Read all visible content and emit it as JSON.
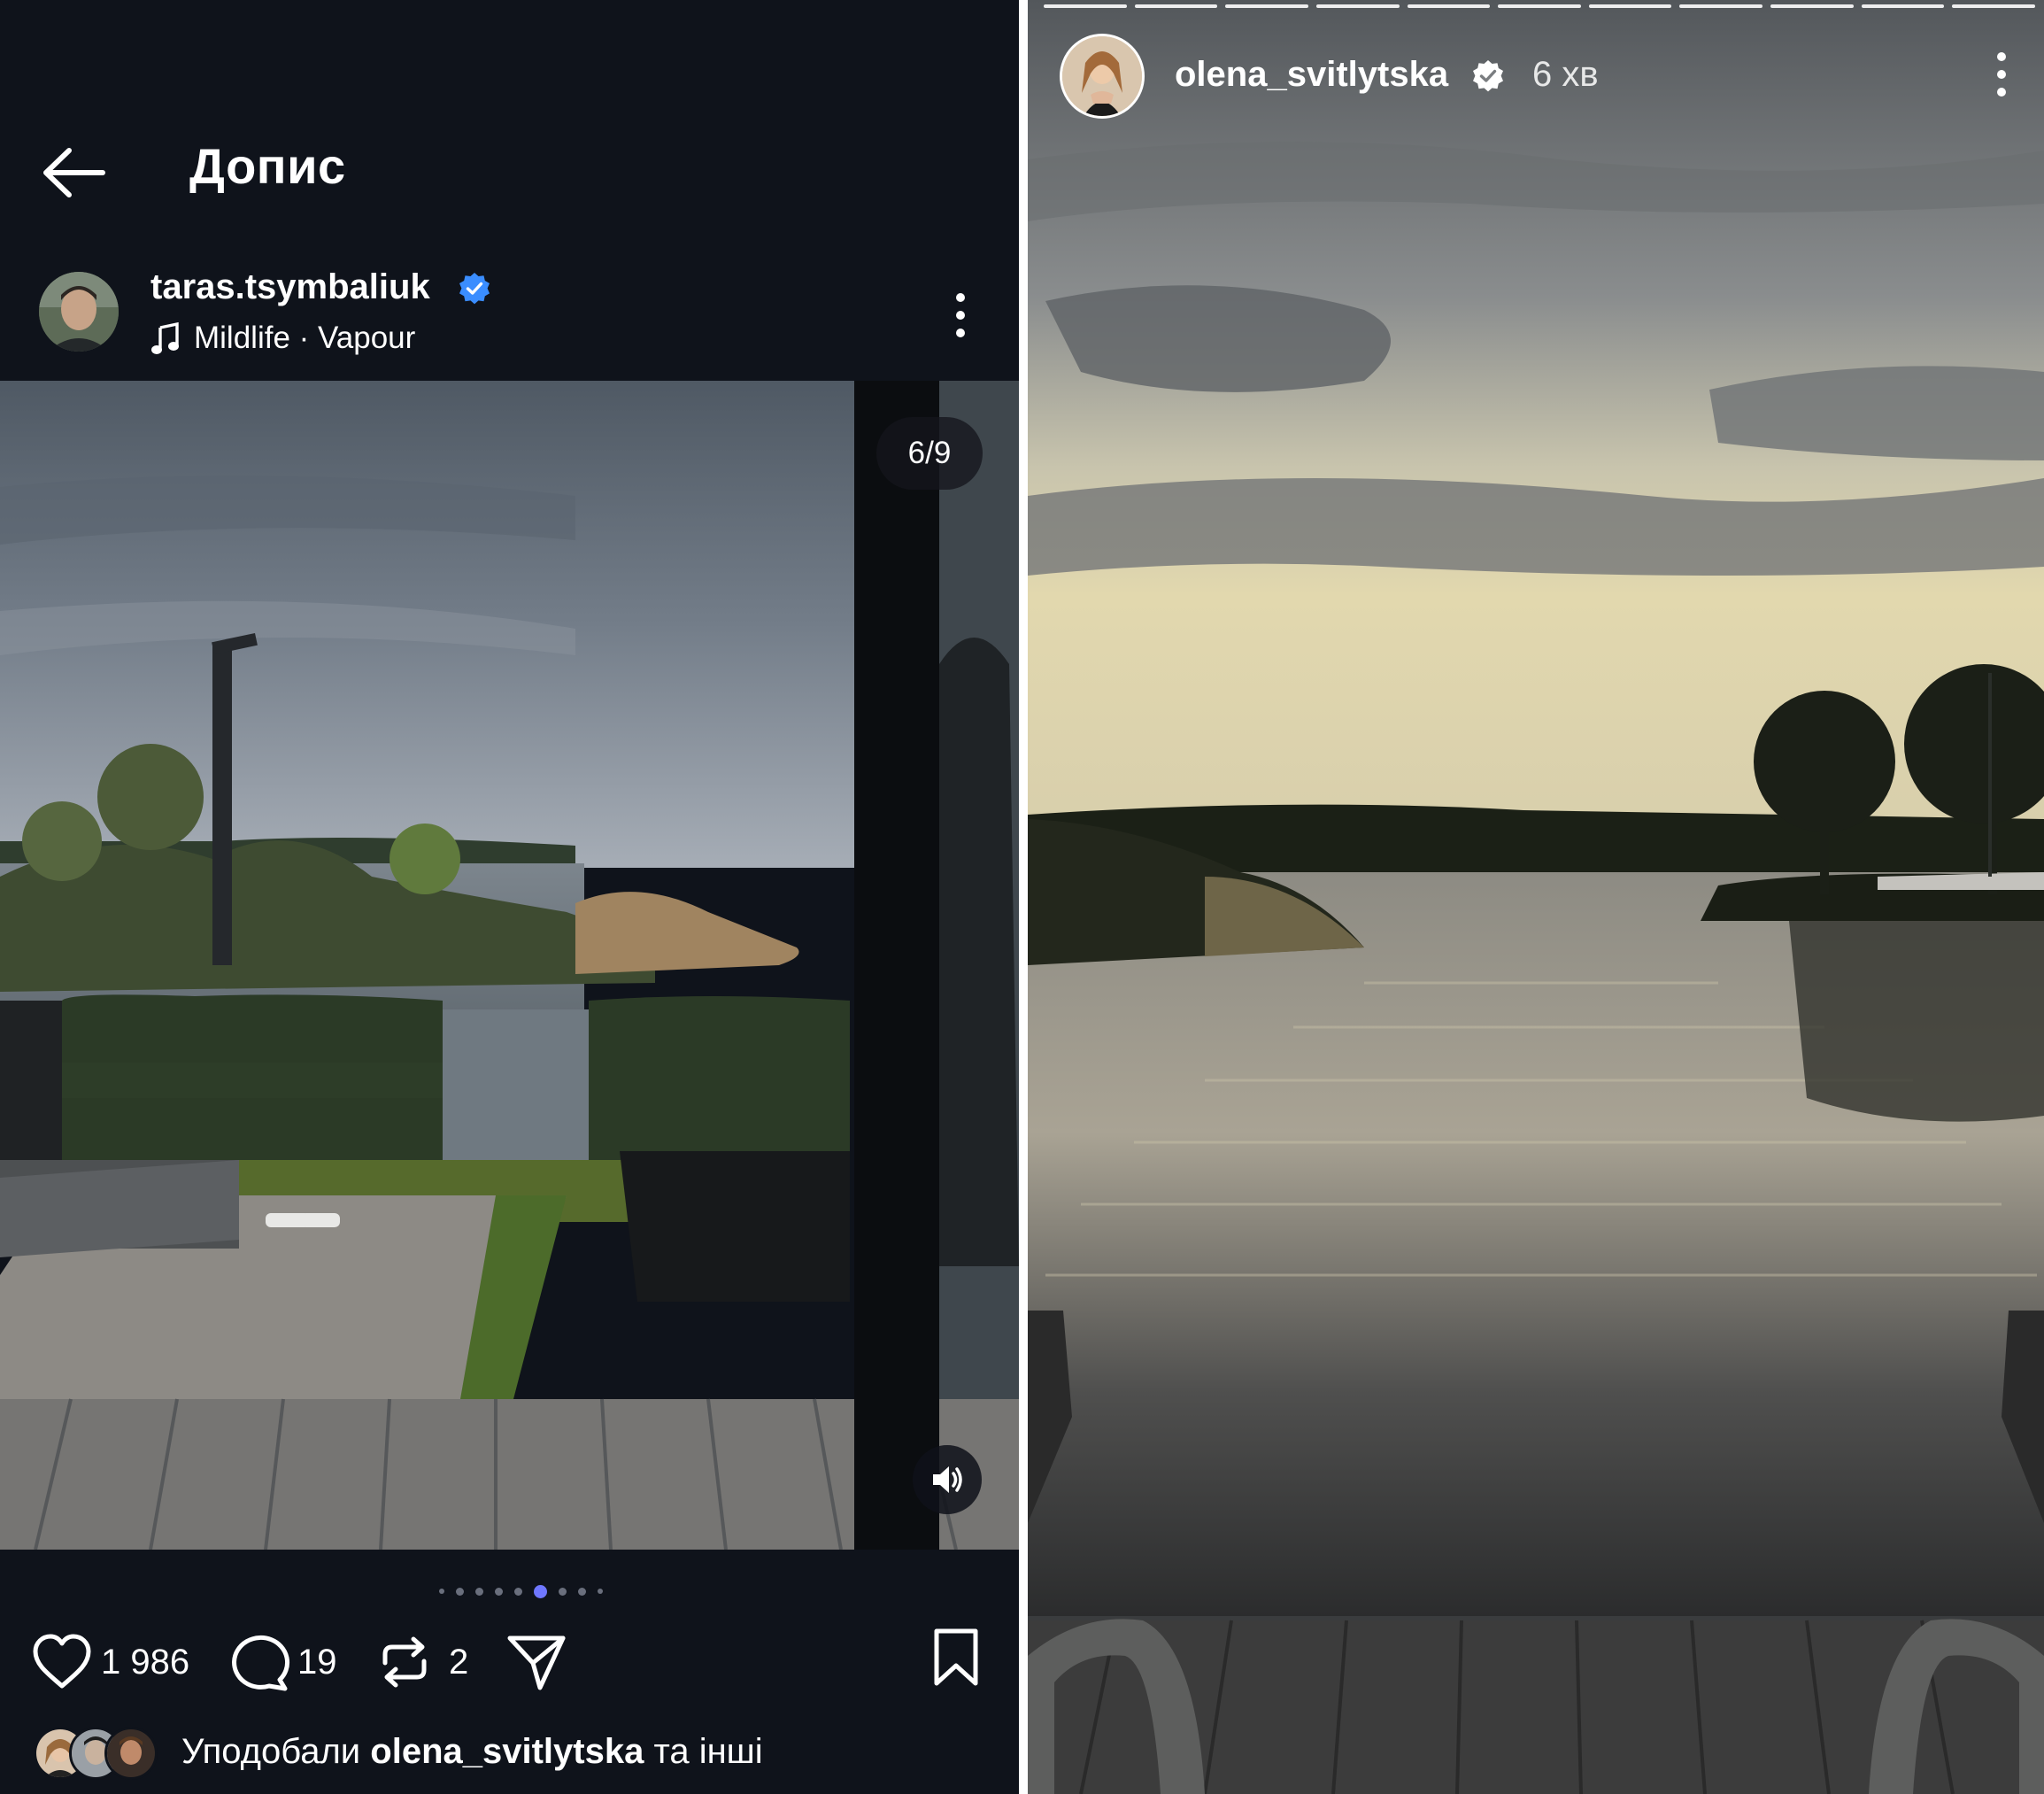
{
  "post": {
    "header_title": "Допис",
    "author": "taras.tsymbaliuk",
    "song": "Mildlife · Vapour",
    "media_counter": "6/9",
    "carousel": {
      "total": 9,
      "active_index": 6
    },
    "likes": "1 986",
    "comments": "19",
    "reposts": "2",
    "liked_by_prefix": "Уподобали",
    "liked_by_user": "olena_svitlytska",
    "liked_by_suffix": "та інші"
  },
  "story": {
    "author": "olena_svitlytska",
    "time": "6 хв",
    "segments": 11
  },
  "icons": {
    "back": "arrow-left-icon",
    "verified": "verified-badge-icon",
    "music": "music-note-icon",
    "more": "more-vertical-icon",
    "sound": "speaker-icon",
    "like": "heart-icon",
    "comment": "comment-bubble-icon",
    "repost": "repost-icon",
    "share": "send-icon",
    "save": "bookmark-icon"
  },
  "colors": {
    "dark_bg": "#0f131b",
    "verified": "#3a8dff",
    "active_dot": "#6f77ff"
  }
}
